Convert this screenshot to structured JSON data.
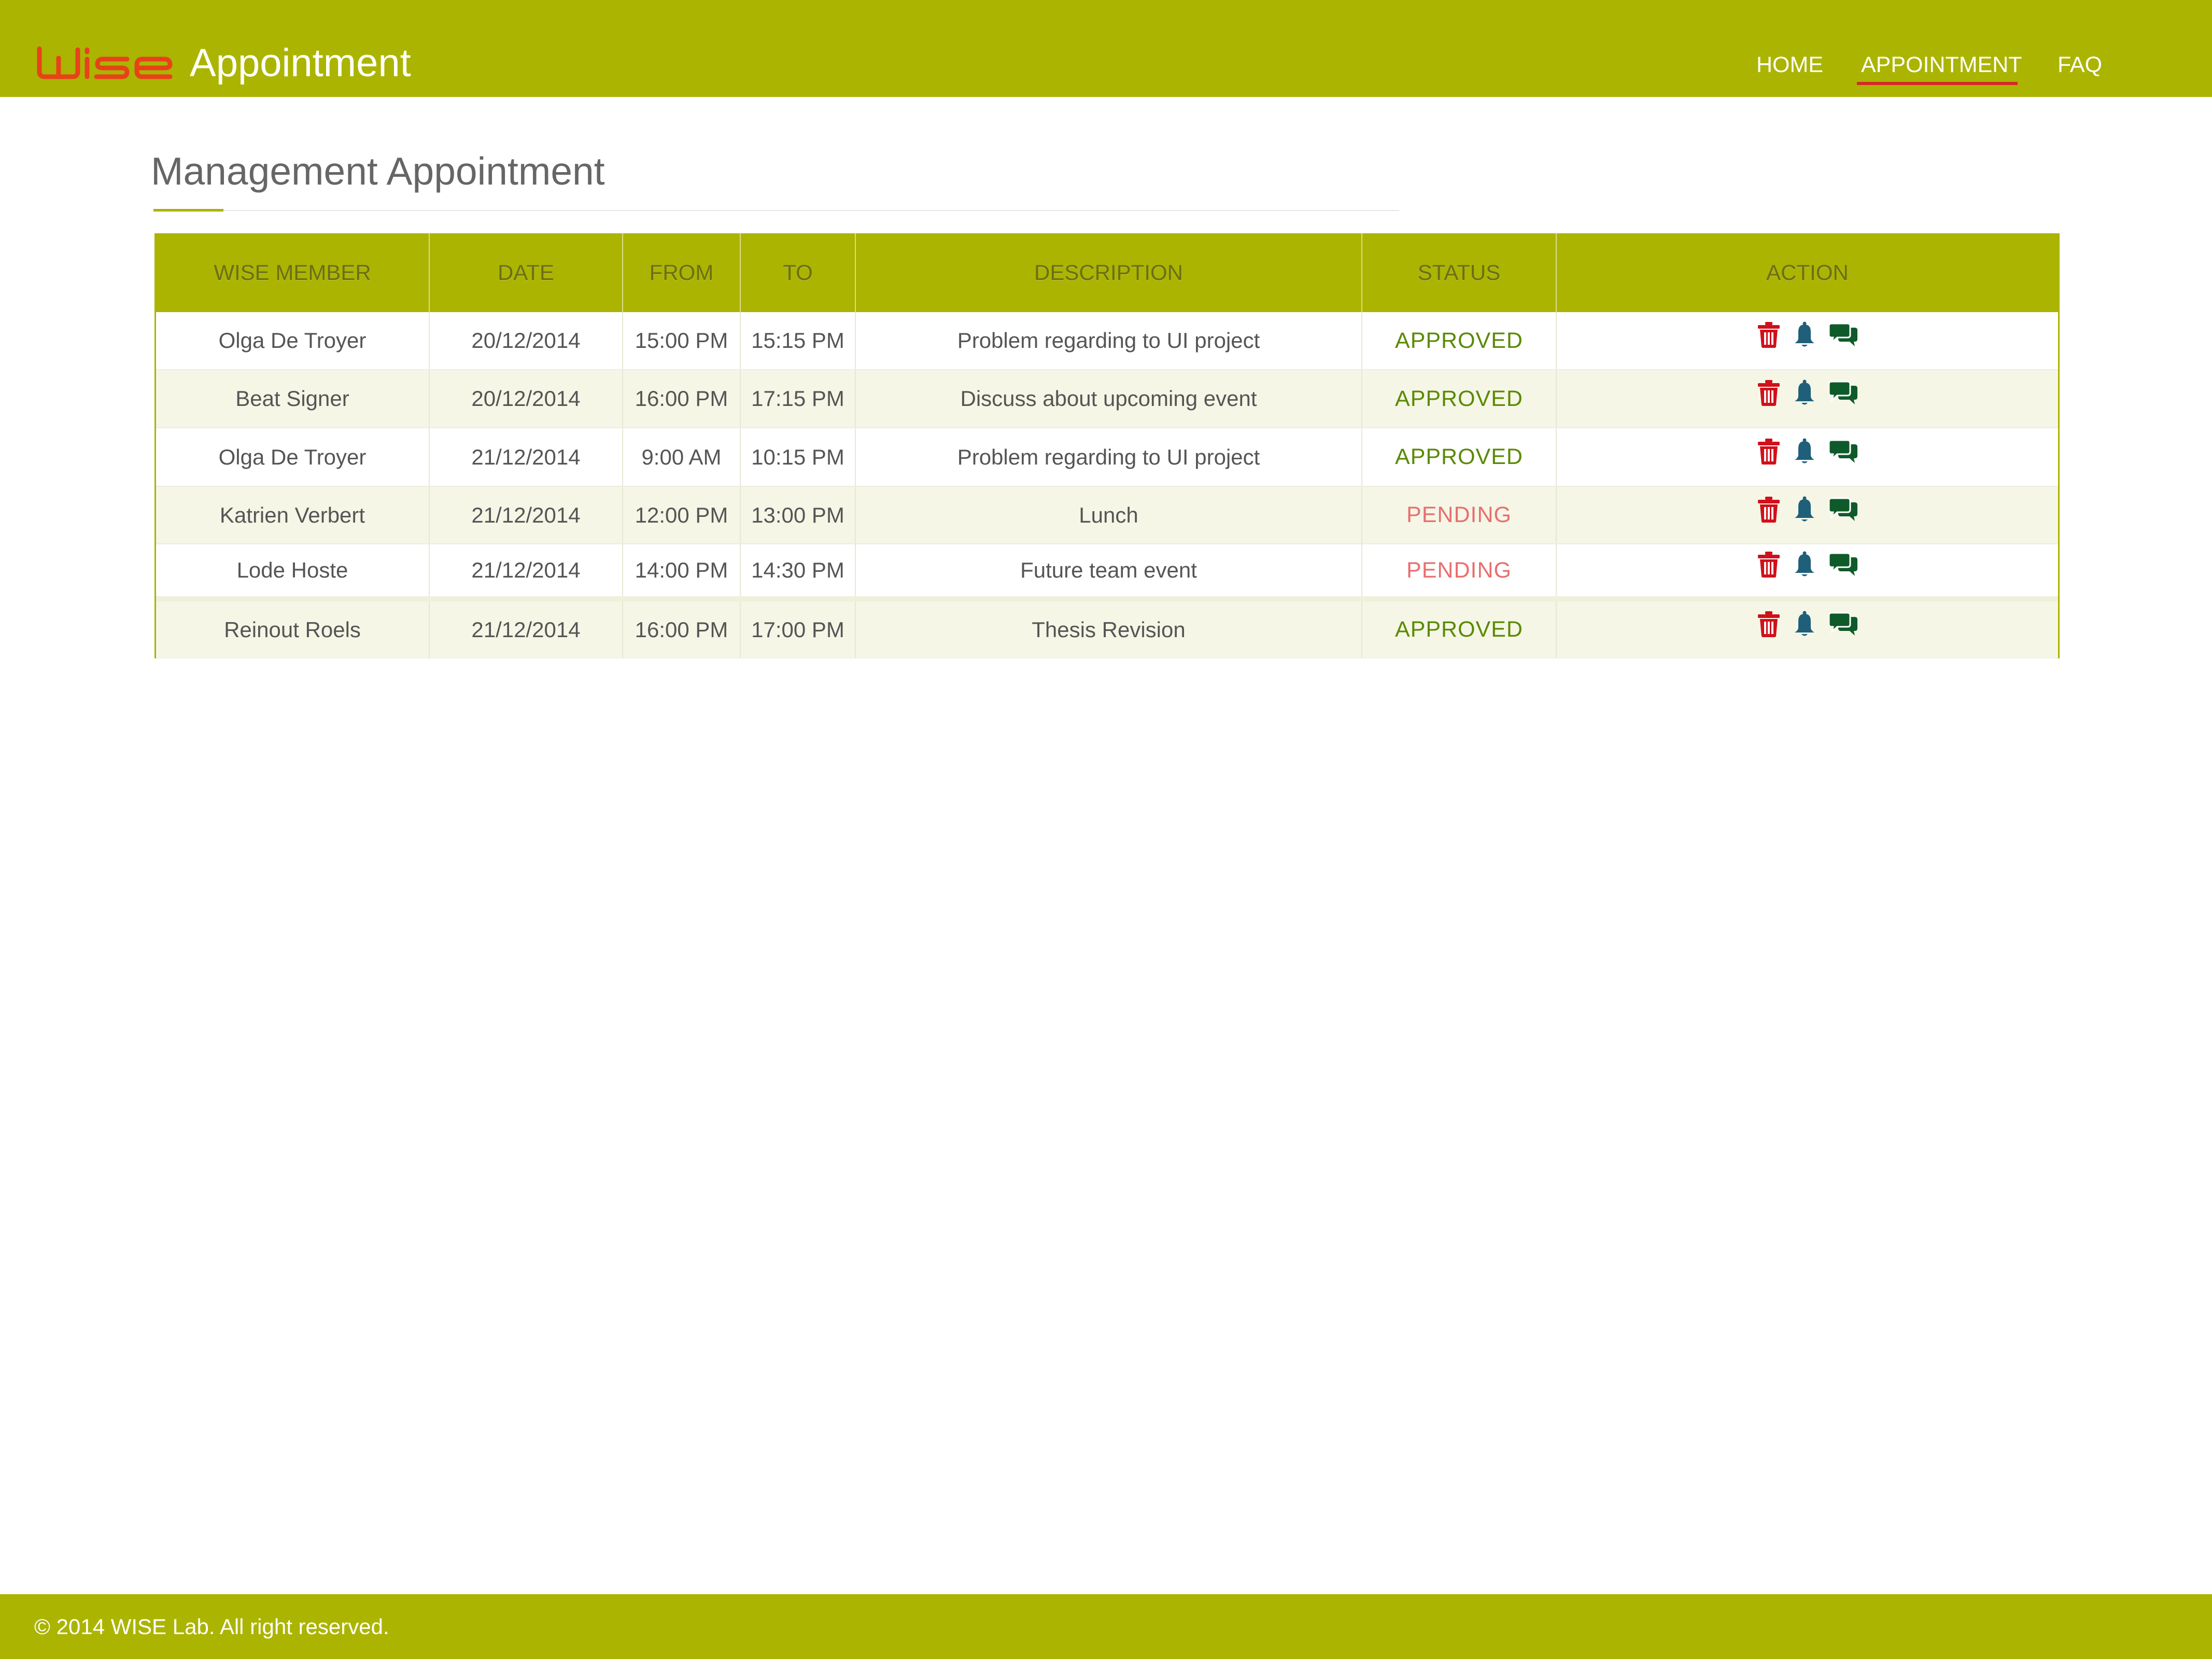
{
  "header": {
    "logo_text": "WISE",
    "title": "Appointment",
    "nav": [
      {
        "label": "HOME",
        "active": false
      },
      {
        "label": "APPOINTMENT",
        "active": true
      },
      {
        "label": "FAQ",
        "active": false
      }
    ]
  },
  "main": {
    "title": "Management Appointment",
    "table": {
      "columns": [
        "WISE MEMBER",
        "DATE",
        "FROM",
        "TO",
        "DESCRIPTION",
        "STATUS",
        "ACTION"
      ],
      "rows": [
        {
          "member": "Olga De Troyer",
          "date": "20/12/2014",
          "from": "15:00 PM",
          "to": "15:15 PM",
          "description": "Problem regarding to UI project",
          "status": "APPROVED"
        },
        {
          "member": "Beat Signer",
          "date": "20/12/2014",
          "from": "16:00 PM",
          "to": "17:15 PM",
          "description": "Discuss about upcoming event",
          "status": "APPROVED"
        },
        {
          "member": "Olga De Troyer",
          "date": "21/12/2014",
          "from": "9:00 AM",
          "to": "10:15 PM",
          "description": "Problem regarding to UI project",
          "status": "APPROVED"
        },
        {
          "member": "Katrien Verbert",
          "date": "21/12/2014",
          "from": "12:00 PM",
          "to": "13:00 PM",
          "description": "Lunch",
          "status": "PENDING"
        },
        {
          "member": "Lode Hoste",
          "date": "21/12/2014",
          "from": "14:00 PM",
          "to": "14:30 PM",
          "description": "Future team event",
          "status": "PENDING"
        },
        {
          "member": "Reinout Roels",
          "date": "21/12/2014",
          "from": "16:00 PM",
          "to": "17:00 PM",
          "description": "Thesis Revision",
          "status": "APPROVED"
        }
      ],
      "row_actions": [
        "trash-icon",
        "bell-icon",
        "chat-icon"
      ]
    }
  },
  "footer": {
    "copyright": "© 2014 WISE Lab. All right reserved."
  },
  "colors": {
    "brand": "#abb400",
    "accent_red": "#d62828",
    "approved": "#5a8a00",
    "pending": "#e86f6f",
    "trash_icon": "#d0101a",
    "bell_icon": "#1f5f7a",
    "chat_icon": "#0f5a2a"
  }
}
